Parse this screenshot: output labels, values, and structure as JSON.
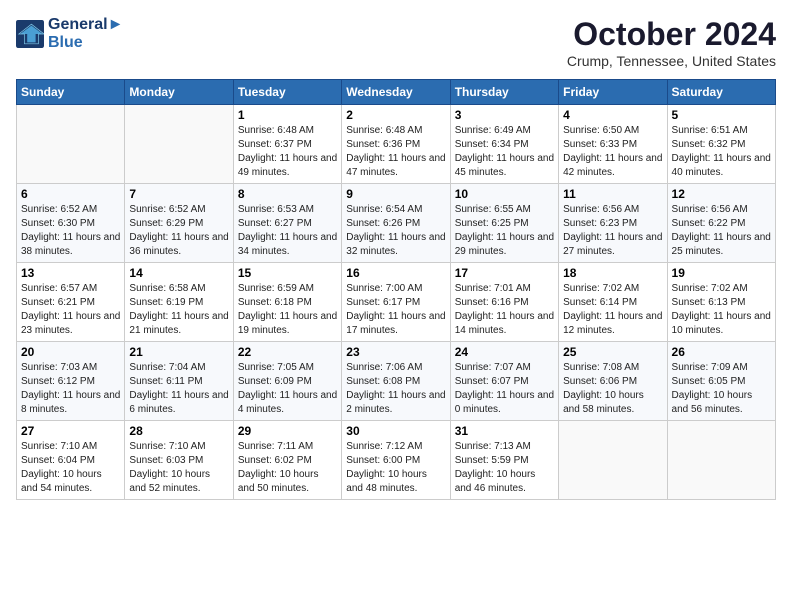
{
  "header": {
    "logo_line1": "General",
    "logo_line2": "Blue",
    "month": "October 2024",
    "location": "Crump, Tennessee, United States"
  },
  "weekdays": [
    "Sunday",
    "Monday",
    "Tuesday",
    "Wednesday",
    "Thursday",
    "Friday",
    "Saturday"
  ],
  "weeks": [
    [
      {
        "day": "",
        "empty": true
      },
      {
        "day": "",
        "empty": true
      },
      {
        "day": "1",
        "sunrise": "6:48 AM",
        "sunset": "6:37 PM",
        "daylight": "11 hours and 49 minutes."
      },
      {
        "day": "2",
        "sunrise": "6:48 AM",
        "sunset": "6:36 PM",
        "daylight": "11 hours and 47 minutes."
      },
      {
        "day": "3",
        "sunrise": "6:49 AM",
        "sunset": "6:34 PM",
        "daylight": "11 hours and 45 minutes."
      },
      {
        "day": "4",
        "sunrise": "6:50 AM",
        "sunset": "6:33 PM",
        "daylight": "11 hours and 42 minutes."
      },
      {
        "day": "5",
        "sunrise": "6:51 AM",
        "sunset": "6:32 PM",
        "daylight": "11 hours and 40 minutes."
      }
    ],
    [
      {
        "day": "6",
        "sunrise": "6:52 AM",
        "sunset": "6:30 PM",
        "daylight": "11 hours and 38 minutes."
      },
      {
        "day": "7",
        "sunrise": "6:52 AM",
        "sunset": "6:29 PM",
        "daylight": "11 hours and 36 minutes."
      },
      {
        "day": "8",
        "sunrise": "6:53 AM",
        "sunset": "6:27 PM",
        "daylight": "11 hours and 34 minutes."
      },
      {
        "day": "9",
        "sunrise": "6:54 AM",
        "sunset": "6:26 PM",
        "daylight": "11 hours and 32 minutes."
      },
      {
        "day": "10",
        "sunrise": "6:55 AM",
        "sunset": "6:25 PM",
        "daylight": "11 hours and 29 minutes."
      },
      {
        "day": "11",
        "sunrise": "6:56 AM",
        "sunset": "6:23 PM",
        "daylight": "11 hours and 27 minutes."
      },
      {
        "day": "12",
        "sunrise": "6:56 AM",
        "sunset": "6:22 PM",
        "daylight": "11 hours and 25 minutes."
      }
    ],
    [
      {
        "day": "13",
        "sunrise": "6:57 AM",
        "sunset": "6:21 PM",
        "daylight": "11 hours and 23 minutes."
      },
      {
        "day": "14",
        "sunrise": "6:58 AM",
        "sunset": "6:19 PM",
        "daylight": "11 hours and 21 minutes."
      },
      {
        "day": "15",
        "sunrise": "6:59 AM",
        "sunset": "6:18 PM",
        "daylight": "11 hours and 19 minutes."
      },
      {
        "day": "16",
        "sunrise": "7:00 AM",
        "sunset": "6:17 PM",
        "daylight": "11 hours and 17 minutes."
      },
      {
        "day": "17",
        "sunrise": "7:01 AM",
        "sunset": "6:16 PM",
        "daylight": "11 hours and 14 minutes."
      },
      {
        "day": "18",
        "sunrise": "7:02 AM",
        "sunset": "6:14 PM",
        "daylight": "11 hours and 12 minutes."
      },
      {
        "day": "19",
        "sunrise": "7:02 AM",
        "sunset": "6:13 PM",
        "daylight": "11 hours and 10 minutes."
      }
    ],
    [
      {
        "day": "20",
        "sunrise": "7:03 AM",
        "sunset": "6:12 PM",
        "daylight": "11 hours and 8 minutes."
      },
      {
        "day": "21",
        "sunrise": "7:04 AM",
        "sunset": "6:11 PM",
        "daylight": "11 hours and 6 minutes."
      },
      {
        "day": "22",
        "sunrise": "7:05 AM",
        "sunset": "6:09 PM",
        "daylight": "11 hours and 4 minutes."
      },
      {
        "day": "23",
        "sunrise": "7:06 AM",
        "sunset": "6:08 PM",
        "daylight": "11 hours and 2 minutes."
      },
      {
        "day": "24",
        "sunrise": "7:07 AM",
        "sunset": "6:07 PM",
        "daylight": "11 hours and 0 minutes."
      },
      {
        "day": "25",
        "sunrise": "7:08 AM",
        "sunset": "6:06 PM",
        "daylight": "10 hours and 58 minutes."
      },
      {
        "day": "26",
        "sunrise": "7:09 AM",
        "sunset": "6:05 PM",
        "daylight": "10 hours and 56 minutes."
      }
    ],
    [
      {
        "day": "27",
        "sunrise": "7:10 AM",
        "sunset": "6:04 PM",
        "daylight": "10 hours and 54 minutes."
      },
      {
        "day": "28",
        "sunrise": "7:10 AM",
        "sunset": "6:03 PM",
        "daylight": "10 hours and 52 minutes."
      },
      {
        "day": "29",
        "sunrise": "7:11 AM",
        "sunset": "6:02 PM",
        "daylight": "10 hours and 50 minutes."
      },
      {
        "day": "30",
        "sunrise": "7:12 AM",
        "sunset": "6:00 PM",
        "daylight": "10 hours and 48 minutes."
      },
      {
        "day": "31",
        "sunrise": "7:13 AM",
        "sunset": "5:59 PM",
        "daylight": "10 hours and 46 minutes."
      },
      {
        "day": "",
        "empty": true
      },
      {
        "day": "",
        "empty": true
      }
    ]
  ],
  "labels": {
    "sunrise": "Sunrise:",
    "sunset": "Sunset:",
    "daylight": "Daylight:"
  }
}
